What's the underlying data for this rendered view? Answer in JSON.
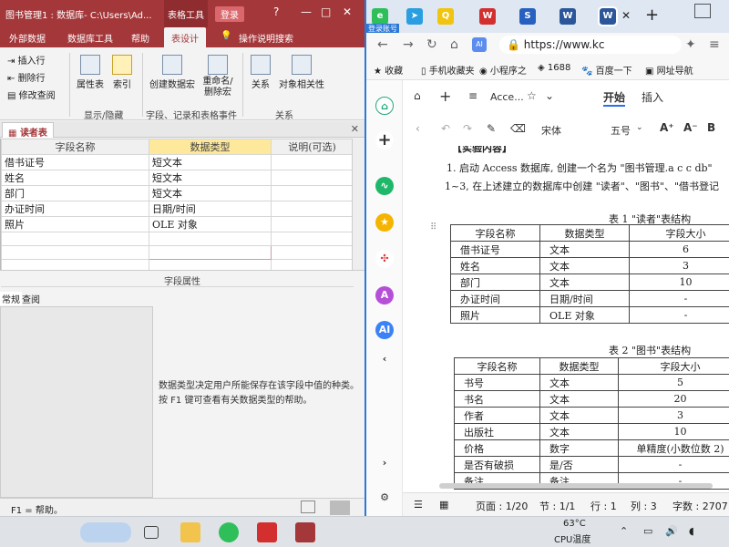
{
  "access": {
    "title": "图书管理1 : 数据库- C:\\Users\\Ad...",
    "context_tab": "表格工具",
    "login": "登录",
    "window_buttons": {
      "help": "?",
      "minimize": "—",
      "restore": "□",
      "close": "✕"
    },
    "tabs": [
      "外部数据",
      "数据库工具",
      "帮助",
      "表设计",
      "操作说明搜索"
    ],
    "active_tab": "表设计",
    "ribbon": {
      "insert_row": "插入行",
      "delete_row": "删除行",
      "modify_lookup": "修改查阅",
      "property_sheet": "属性表",
      "indexes": "索引",
      "create_macro": "创建数据宏",
      "rename_macro": "重命名/删除宏",
      "relationships": "关系",
      "object_dependencies": "对象相关性",
      "group_show_hide": "显示/隐藏",
      "group_field_events": "字段、记录和表格事件",
      "group_relationships": "关系"
    },
    "doc_tab": "读者表",
    "grid": {
      "headers": [
        "字段名称",
        "数据类型",
        "说明(可选)"
      ],
      "rows": [
        [
          "借书证号",
          "短文本",
          ""
        ],
        [
          "姓名",
          "短文本",
          ""
        ],
        [
          "部门",
          "短文本",
          ""
        ],
        [
          "办证时间",
          "日期/时间",
          ""
        ],
        [
          "照片",
          "OLE 对象",
          ""
        ],
        [
          "",
          "",
          ""
        ],
        [
          "",
          "",
          ""
        ],
        [
          "",
          "",
          ""
        ],
        [
          "",
          "",
          ""
        ]
      ]
    },
    "field_properties_label": "字段属性",
    "prop_tabs": [
      "常规",
      "查阅"
    ],
    "help_text": "数据类型决定用户所能保存在该字段中值的种类。按 F1 键可查看有关数据类型的帮助。",
    "status": "F1 = 帮助。"
  },
  "browser": {
    "login_account": "登录账号",
    "url": "https://www.kc",
    "bookmarks": [
      "收藏",
      "手机收藏夹",
      "小程序之",
      "1688",
      "百度一下",
      "网址导航"
    ],
    "wps": {
      "doc_name": "Acce...",
      "tabs": [
        "开始",
        "插入"
      ],
      "font": "宋体",
      "font_size": "五号"
    },
    "doc": {
      "heading_fragment": "【实验内容】",
      "line1": "1. 启动 Access 数据库, 创建一个名为 \"图书管理.a c c db\"",
      "line2": "1~3, 在上述建立的数据库中创建 \"读者\"、\"图书\"、\"借书登记",
      "table1_caption": "表 1  \"读者\"表结构",
      "table1": {
        "headers": [
          "字段名称",
          "数据类型",
          "字段大小"
        ],
        "rows": [
          [
            "借书证号",
            "文本",
            "6"
          ],
          [
            "姓名",
            "文本",
            "3"
          ],
          [
            "部门",
            "文本",
            "10"
          ],
          [
            "办证时间",
            "日期/时间",
            "-"
          ],
          [
            "照片",
            "OLE 对象",
            "-"
          ]
        ]
      },
      "table2_caption": "表 2  \"图书\"表结构",
      "table2": {
        "headers": [
          "字段名称",
          "数据类型",
          "字段大小"
        ],
        "rows": [
          [
            "书号",
            "文本",
            "5"
          ],
          [
            "书名",
            "文本",
            "20"
          ],
          [
            "作者",
            "文本",
            "3"
          ],
          [
            "出版社",
            "文本",
            "10"
          ],
          [
            "价格",
            "数字",
            "单精度(小数位数 2)"
          ],
          [
            "是否有破损",
            "是/否",
            "-"
          ],
          [
            "备注",
            "备注",
            "-"
          ]
        ]
      }
    },
    "status": {
      "page": "页面 : 1/20",
      "section": "节 : 1/1",
      "line": "行 : 1",
      "col": "列 : 3",
      "words": "字数 : 2707"
    }
  },
  "taskbar": {
    "temp": "63°C",
    "temp_label": "CPU温度"
  }
}
